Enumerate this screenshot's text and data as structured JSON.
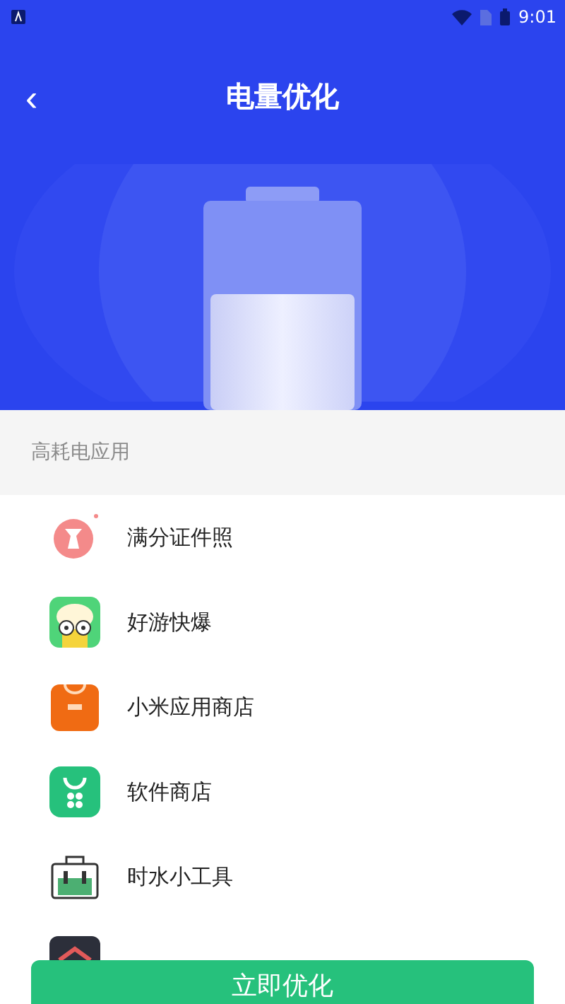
{
  "status_bar": {
    "time": "9:01"
  },
  "header": {
    "title": "电量优化",
    "back": "‹"
  },
  "section": {
    "title": "高耗电应用"
  },
  "apps": [
    {
      "name": "满分证件照",
      "kind": "photo"
    },
    {
      "name": "好游快爆",
      "kind": "game"
    },
    {
      "name": "小米应用商店",
      "kind": "mistore"
    },
    {
      "name": "软件商店",
      "kind": "store"
    },
    {
      "name": "时水小工具",
      "kind": "toolbox"
    },
    {
      "kind": "service"
    }
  ],
  "action": {
    "label": "立即优化"
  }
}
